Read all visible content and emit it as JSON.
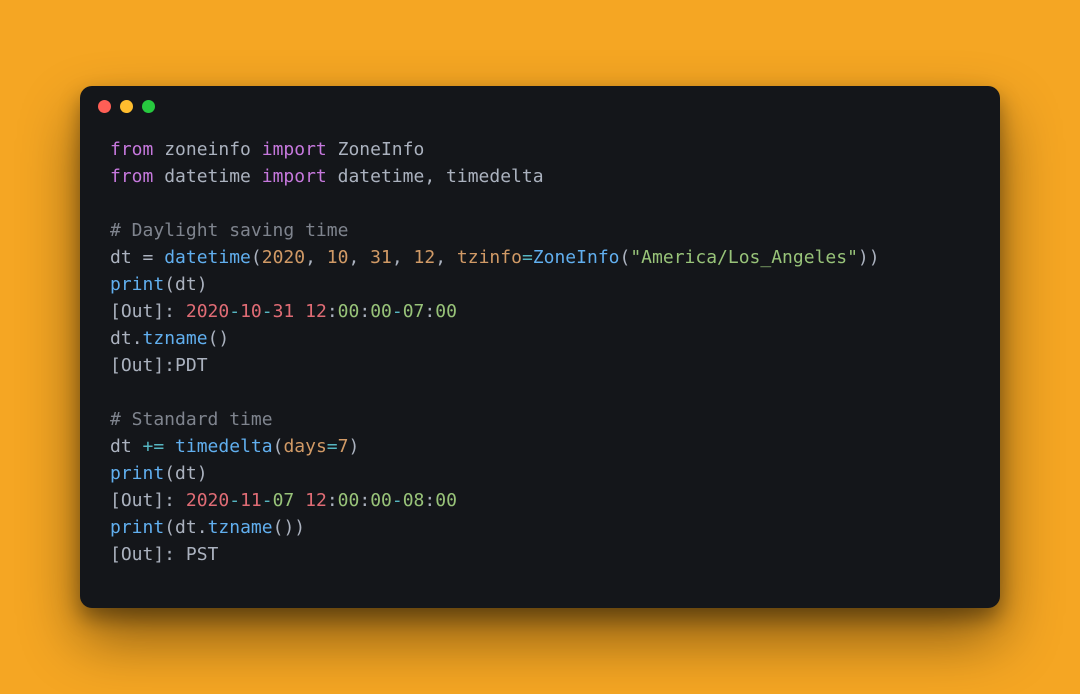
{
  "colors": {
    "background": "#f5a623",
    "window": "#14161a",
    "dot_red": "#ff5f56",
    "dot_yellow": "#ffbd2e",
    "dot_green": "#27c93f",
    "kw": "#c678dd",
    "fn": "#61afef",
    "num": "#d19a66",
    "str": "#98c379",
    "com": "#7f848e",
    "op": "#56b6c2",
    "red": "#e06c75",
    "default": "#abb2bf"
  },
  "code": {
    "line1": {
      "from_kw": "from",
      "mod1": "zoneinfo",
      "import_kw": "import",
      "name1": "ZoneInfo"
    },
    "line2": {
      "from_kw": "from",
      "mod2": "datetime",
      "import_kw": "import",
      "name2a": "datetime",
      "comma": ", ",
      "name2b": "timedelta"
    },
    "line3_blank": "",
    "line4_comment": "# Daylight saving time",
    "line5": {
      "lhs": "dt",
      "assign": " = ",
      "call": "datetime",
      "lp": "(",
      "n1": "2020",
      "c1": ", ",
      "n2": "10",
      "c2": ", ",
      "n3": "31",
      "c3": ", ",
      "n4": "12",
      "c4": ", ",
      "kwarg": "tzinfo",
      "eq": "=",
      "call2": "ZoneInfo",
      "lp2": "(",
      "strq": "\"America/Los_Angeles\"",
      "rp2": ")",
      "rp": ")"
    },
    "line6": {
      "call": "print",
      "lp": "(",
      "arg": "dt",
      "rp": ")"
    },
    "line7": {
      "label": "[Out]: ",
      "d_y": "2020",
      "dash1": "-",
      "d_m": "10",
      "dash2": "-",
      "d_d": "31",
      "sp": " ",
      "t_h": "12",
      "col1": ":",
      "t_m": "00",
      "col2": ":",
      "t_s": "00",
      "off_sign": "-",
      "off_h": "07",
      "off_col": ":",
      "off_m": "00"
    },
    "line8": {
      "obj": "dt",
      "dot": ".",
      "meth": "tzname",
      "lp": "(",
      "rp": ")"
    },
    "line9": {
      "label": "[Out]:",
      "val": "PDT"
    },
    "line10_blank": "",
    "line11_comment": "# Standard time",
    "line12": {
      "lhs": "dt",
      "op": " += ",
      "call": "timedelta",
      "lp": "(",
      "kwarg": "days",
      "eq": "=",
      "n": "7",
      "rp": ")"
    },
    "line13": {
      "call": "print",
      "lp": "(",
      "arg": "dt",
      "rp": ")"
    },
    "line14": {
      "label": "[Out]: ",
      "d_y": "2020",
      "dash1": "-",
      "d_m": "11",
      "dash2": "-",
      "d_d": "07",
      "sp": " ",
      "t_h": "12",
      "col1": ":",
      "t_m": "00",
      "col2": ":",
      "t_s": "00",
      "off_sign": "-",
      "off_h": "08",
      "off_col": ":",
      "off_m": "00"
    },
    "line15": {
      "call": "print",
      "lp": "(",
      "obj": "dt",
      "dot": ".",
      "meth": "tzname",
      "lp2": "(",
      "rp2": ")",
      "rp": ")"
    },
    "line16": {
      "label": "[Out]: ",
      "val": "PST"
    }
  }
}
